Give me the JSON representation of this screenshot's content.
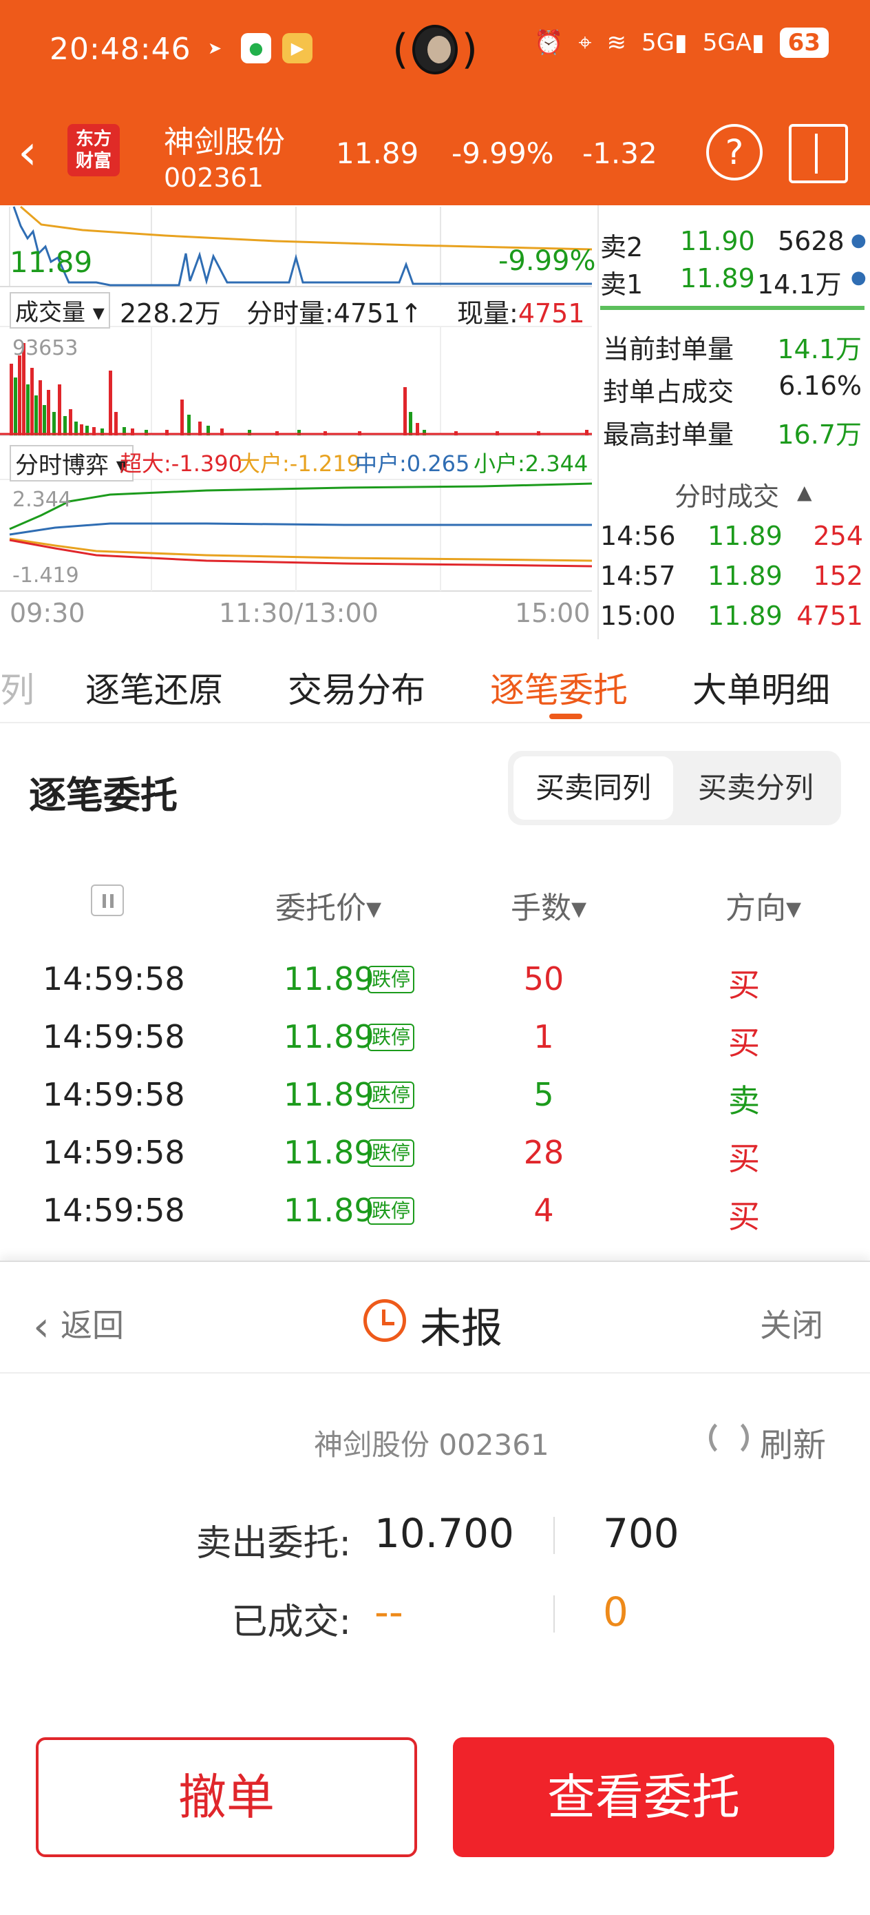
{
  "status_bar": {
    "time": "20:48:46",
    "battery": "63"
  },
  "header": {
    "logo_line1": "东方",
    "logo_line2": "财富",
    "stock_name": "神剑股份",
    "stock_code": "002361",
    "price": "11.89",
    "pct_change": "-9.99%",
    "change": "-1.32"
  },
  "chart": {
    "price_label": "11.89",
    "pct_label": "-9.99%",
    "volume_selector": "成交量",
    "volume_total": "228.2万",
    "tick_volume": "分时量:4751",
    "current_volume_label": "现量:",
    "current_volume_value": "4751",
    "volume_max": "93653",
    "game_selector": "分时博弈",
    "super_large": "超大:-1.390",
    "large": "大户:-1.219",
    "medium": "中户:0.265",
    "small": "小户:2.344",
    "game_top": "2.344",
    "game_bottom": "-1.419",
    "time_start": "09:30",
    "time_mid": "11:30/13:00",
    "time_end": "15:00"
  },
  "order_book": {
    "sell2_label": "卖2",
    "sell2_price": "11.90",
    "sell2_vol": "5628",
    "sell1_label": "卖1",
    "sell1_price": "11.89",
    "sell1_vol": "14.1万"
  },
  "seal_stats": [
    {
      "label": "当前封单量",
      "value": "14.1万"
    },
    {
      "label": "封单占成交",
      "value": "6.16%"
    },
    {
      "label": "最高封单量",
      "value": "16.7万"
    }
  ],
  "time_sales": {
    "title": "分时成交",
    "rows": [
      {
        "time": "14:56",
        "price": "11.89",
        "vol": "254"
      },
      {
        "time": "14:57",
        "price": "11.89",
        "vol": "152"
      },
      {
        "time": "15:00",
        "price": "11.89",
        "vol": "4751"
      }
    ]
  },
  "tabs": [
    {
      "label": "列"
    },
    {
      "label": "逐笔还原"
    },
    {
      "label": "交易分布"
    },
    {
      "label": "逐笔委托"
    },
    {
      "label": "大单明细"
    }
  ],
  "tick_orders": {
    "title": "逐笔委托",
    "toggle_on": "买卖同列",
    "toggle_off": "买卖分列",
    "col_price": "委托价",
    "col_qty": "手数",
    "col_dir": "方向",
    "limit_tag": "跌停",
    "rows": [
      {
        "time": "14:59:58",
        "price": "11.89",
        "qty": "50",
        "dir": "买"
      },
      {
        "time": "14:59:58",
        "price": "11.89",
        "qty": "1",
        "dir": "买"
      },
      {
        "time": "14:59:58",
        "price": "11.89",
        "qty": "5",
        "dir": "卖"
      },
      {
        "time": "14:59:58",
        "price": "11.89",
        "qty": "28",
        "dir": "买"
      },
      {
        "time": "14:59:58",
        "price": "11.89",
        "qty": "4",
        "dir": "买"
      }
    ]
  },
  "sheet": {
    "back_label": "返回",
    "title": "未报",
    "close_label": "关闭",
    "stock": "神剑股份 002361",
    "refresh_label": "刷新",
    "sell_label": "卖出委托:",
    "sell_price": "10.700",
    "sell_qty": "700",
    "filled_label": "已成交:",
    "filled_price": "--",
    "filled_qty": "0",
    "cancel_button": "撤单",
    "view_button": "查看委托"
  },
  "colors": {
    "brand": "#EE5A1A",
    "up": "#E0262B",
    "down": "#1C9B1C",
    "price_line": "#2F6DB3",
    "avg_line": "#E8A21F"
  }
}
